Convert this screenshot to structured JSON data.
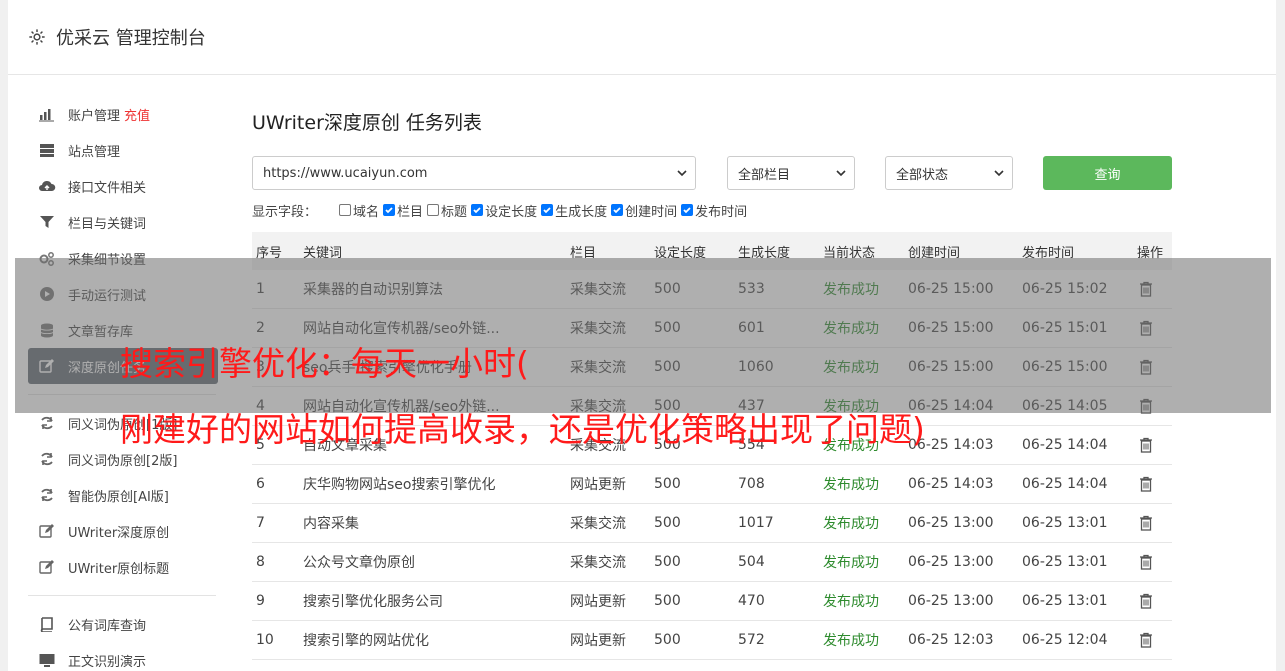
{
  "header": {
    "title": "优采云 管理控制台",
    "icon": "gear-icon"
  },
  "sidebar": {
    "items": [
      {
        "label": "账户管理",
        "tag": "充值",
        "icon": "bar-chart-icon"
      },
      {
        "label": "站点管理",
        "icon": "server-icon"
      },
      {
        "label": "接口文件相关",
        "icon": "cloud-upload-icon"
      },
      {
        "label": "栏目与关键词",
        "icon": "filter-icon"
      },
      {
        "label": "采集细节设置",
        "icon": "gears-icon"
      },
      {
        "label": "手动运行测试",
        "icon": "play-icon"
      },
      {
        "label": "文章暂存库",
        "icon": "database-icon"
      },
      {
        "label": "深度原创任务",
        "icon": "edit-icon",
        "active": true
      },
      {
        "label": "同义词伪原创[1版]",
        "icon": "refresh-icon"
      },
      {
        "label": "同义词伪原创[2版]",
        "icon": "refresh-icon"
      },
      {
        "label": "智能伪原创[AI版]",
        "icon": "refresh-icon"
      },
      {
        "label": "UWriter深度原创",
        "icon": "edit-icon"
      },
      {
        "label": "UWriter原创标题",
        "icon": "edit-icon"
      },
      {
        "label": "公有词库查询",
        "icon": "book-icon"
      },
      {
        "label": "正文识别演示",
        "icon": "monitor-icon"
      }
    ]
  },
  "main": {
    "title": "UWriter深度原创 任务列表",
    "site_select": "https://www.ucaiyun.com",
    "column_select": "全部栏目",
    "status_select": "全部状态",
    "query_label": "查询",
    "fields_label": "显示字段：",
    "fields": [
      {
        "label": "域名",
        "checked": false
      },
      {
        "label": "栏目",
        "checked": true
      },
      {
        "label": "标题",
        "checked": false
      },
      {
        "label": "设定长度",
        "checked": true
      },
      {
        "label": "生成长度",
        "checked": true
      },
      {
        "label": "创建时间",
        "checked": true
      },
      {
        "label": "发布时间",
        "checked": true
      }
    ],
    "columns": [
      "序号",
      "关键词",
      "栏目",
      "设定长度",
      "生成长度",
      "当前状态",
      "创建时间",
      "发布时间",
      "操作"
    ],
    "rows": [
      [
        "1",
        "采集器的自动识别算法",
        "采集交流",
        "500",
        "533",
        "发布成功",
        "06-25 15:00",
        "06-25 15:02"
      ],
      [
        "2",
        "网站自动化宣传机器/seo外链...",
        "采集交流",
        "500",
        "601",
        "发布成功",
        "06-25 15:00",
        "06-25 15:01"
      ],
      [
        "3",
        "seo兵手 搜索引擎优化手册",
        "采集交流",
        "500",
        "1060",
        "发布成功",
        "06-25 15:00",
        "06-25 15:00"
      ],
      [
        "4",
        "网站自动化宣传机器/seo外链...",
        "采集交流",
        "500",
        "437",
        "发布成功",
        "06-25 14:04",
        "06-25 14:05"
      ],
      [
        "5",
        "自动文章采集",
        "采集交流",
        "500",
        "554",
        "发布成功",
        "06-25 14:03",
        "06-25 14:04"
      ],
      [
        "6",
        "庆华购物网站seo搜索引擎优化",
        "网站更新",
        "500",
        "708",
        "发布成功",
        "06-25 14:03",
        "06-25 14:04"
      ],
      [
        "7",
        "内容采集",
        "采集交流",
        "500",
        "1017",
        "发布成功",
        "06-25 13:00",
        "06-25 13:01"
      ],
      [
        "8",
        "公众号文章伪原创",
        "采集交流",
        "500",
        "504",
        "发布成功",
        "06-25 13:00",
        "06-25 13:01"
      ],
      [
        "9",
        "搜索引擎优化服务公司",
        "网站更新",
        "500",
        "470",
        "发布成功",
        "06-25 13:00",
        "06-25 13:01"
      ],
      [
        "10",
        "搜索引擎的网站优化",
        "网站更新",
        "500",
        "572",
        "发布成功",
        "06-25 12:03",
        "06-25 12:04"
      ]
    ]
  },
  "overlay": {
    "line1": "搜索引擎优化：每天一小时(",
    "line2": "刚建好的网站如何提高收录，还是优化策略出现了问题)"
  },
  "colors": {
    "accent_green": "#5cb85c",
    "status_green": "#2e8b2e",
    "overlay_text": "#ff1a1a",
    "active_bg": "#5f6872"
  }
}
